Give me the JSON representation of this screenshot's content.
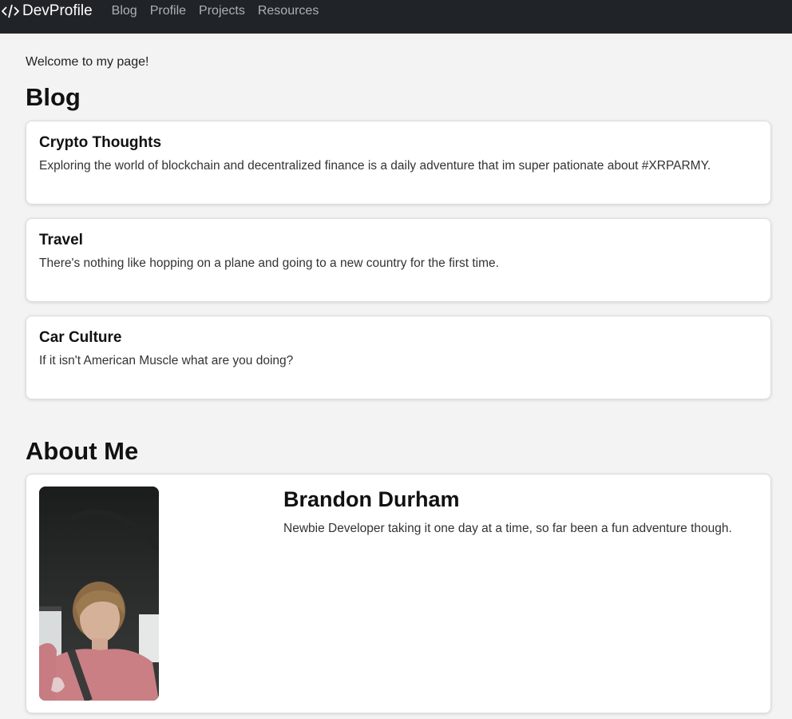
{
  "navbar": {
    "brand": "DevProfile",
    "links": [
      "Blog",
      "Profile",
      "Projects",
      "Resources"
    ]
  },
  "main": {
    "welcome": "Welcome to my page!",
    "blog": {
      "title": "Blog",
      "posts": [
        {
          "title": "Crypto Thoughts",
          "text": "Exploring the world of blockchain and decentralized finance is a daily adventure that im super pationate about #XRPARMY."
        },
        {
          "title": "Travel",
          "text": "There's nothing like hopping on a plane and going to a new country for the first time."
        },
        {
          "title": "Car Culture",
          "text": "If it isn't American Muscle what are you doing?"
        }
      ]
    },
    "about": {
      "title": "About Me",
      "name": "Brandon Durham",
      "bio": "Newbie Developer taking it one day at a time, so far been a fun adventure though."
    }
  },
  "colors": {
    "navbar_bg": "#202327",
    "page_bg": "#f3f3f3",
    "card_bg": "#ffffff"
  }
}
